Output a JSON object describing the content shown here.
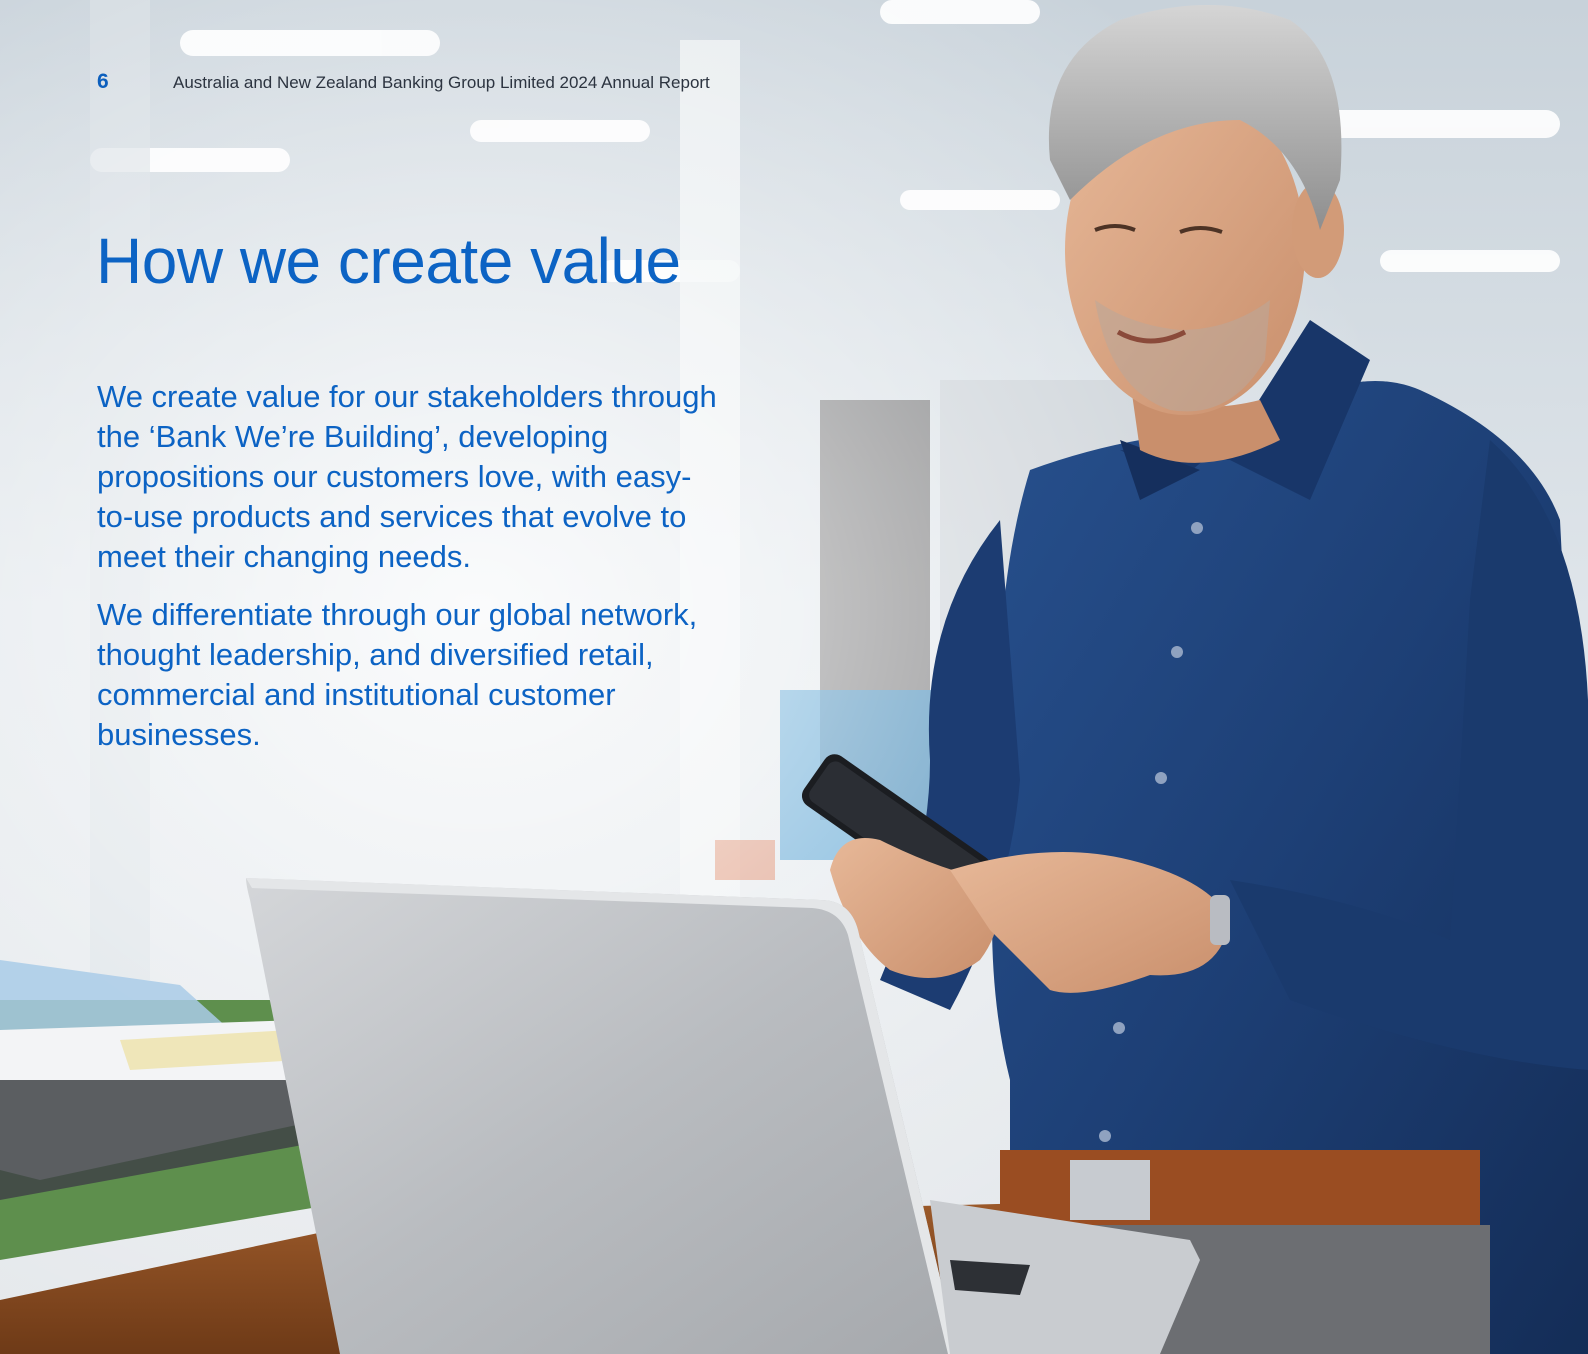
{
  "header": {
    "page_number": "6",
    "report_title": "Australia and New Zealand Banking Group Limited 2024 Annual Report"
  },
  "main": {
    "heading": "How we create value",
    "paragraphs": [
      "We create value for our stakeholders through the ‘Bank We’re Building’, developing propositions our customers love, with easy-to-use products and services that evolve to meet their changing needs.",
      "We differentiate through our global network, thought leadership, and diversified retail, commercial and institutional customer businesses."
    ]
  },
  "colors": {
    "brand_blue": "#0c63c4",
    "shirt_navy": "#1d3f75",
    "header_text": "#2c3440"
  }
}
